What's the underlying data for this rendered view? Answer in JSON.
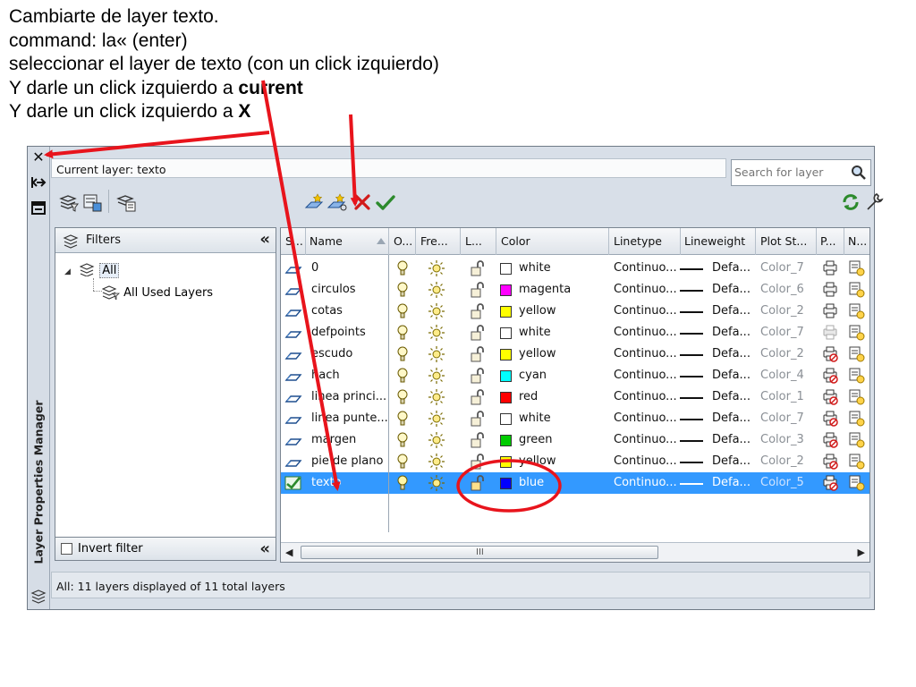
{
  "instructions": {
    "line1": "Cambiarte de layer texto.",
    "line2": "command: la« (enter)",
    "line3": "seleccionar el layer de texto  (con un click izquierdo)",
    "line4_prefix": "Y darle un click izquierdo a ",
    "line4_bold": "current",
    "line5_prefix": "Y darle un click izquierdo a ",
    "line5_bold": "X"
  },
  "window": {
    "palette_title": "Layer Properties Manager",
    "close_glyph": "✕",
    "current_layer": "Current layer: texto",
    "search_placeholder": "Search for layer",
    "status": "All: 11 layers displayed of 11 total layers"
  },
  "filters": {
    "header": "Filters",
    "collapse_glyph": "«",
    "tree": {
      "all": "All",
      "all_used": "All Used Layers"
    },
    "invert_filter": "Invert filter"
  },
  "columns": [
    "S...",
    "Name",
    "O...",
    "Fre...",
    "L...",
    "Color",
    "Linetype",
    "Lineweight",
    "Plot St...",
    "P...",
    "N..."
  ],
  "layers": [
    {
      "name": "0",
      "color_name": "white",
      "color_hex": "#ffffff",
      "linetype": "Continuo...",
      "lineweight": "Defa...",
      "plot_style": "Color_7",
      "selected": false
    },
    {
      "name": "circulos",
      "color_name": "magenta",
      "color_hex": "#ff00ff",
      "linetype": "Continuo...",
      "lineweight": "Defa...",
      "plot_style": "Color_6",
      "selected": false
    },
    {
      "name": "cotas",
      "color_name": "yellow",
      "color_hex": "#ffff00",
      "linetype": "Continuo...",
      "lineweight": "Defa...",
      "plot_style": "Color_2",
      "selected": false
    },
    {
      "name": "defpoints",
      "color_name": "white",
      "color_hex": "#ffffff",
      "linetype": "Continuo...",
      "lineweight": "Defa...",
      "plot_style": "Color_7",
      "selected": false
    },
    {
      "name": "escudo",
      "color_name": "yellow",
      "color_hex": "#ffff00",
      "linetype": "Continuo...",
      "lineweight": "Defa...",
      "plot_style": "Color_2",
      "selected": false
    },
    {
      "name": "hach",
      "color_name": "cyan",
      "color_hex": "#00ffff",
      "linetype": "Continuo...",
      "lineweight": "Defa...",
      "plot_style": "Color_4",
      "selected": false
    },
    {
      "name": "linea princi...",
      "color_name": "red",
      "color_hex": "#ff0000",
      "linetype": "Continuo...",
      "lineweight": "Defa...",
      "plot_style": "Color_1",
      "selected": false
    },
    {
      "name": "linea punte...",
      "color_name": "white",
      "color_hex": "#ffffff",
      "linetype": "Continuo...",
      "lineweight": "Defa...",
      "plot_style": "Color_7",
      "selected": false
    },
    {
      "name": "margen",
      "color_name": "green",
      "color_hex": "#00cc00",
      "linetype": "Continuo...",
      "lineweight": "Defa...",
      "plot_style": "Color_3",
      "selected": false
    },
    {
      "name": "pie de plano",
      "color_name": "yellow",
      "color_hex": "#ffff00",
      "linetype": "Continuo...",
      "lineweight": "Defa...",
      "plot_style": "Color_2",
      "selected": false
    },
    {
      "name": "texto",
      "color_name": "blue",
      "color_hex": "#0000ff",
      "linetype": "Continuo...",
      "lineweight": "Defa...",
      "plot_style": "Color_5",
      "selected": true
    }
  ],
  "scrollbar_grip": "III",
  "icons": {
    "new_filter": "new-property-filter-icon",
    "new_group": "new-group-filter-icon",
    "states": "layer-states-manager-icon",
    "new_layer": "new-layer-icon",
    "new_vp_layer": "new-layer-vp-frozen-icon",
    "delete": "delete-layer-icon",
    "set_current": "set-current-icon",
    "refresh": "refresh-icon",
    "settings": "settings-wrench-icon"
  },
  "annotation_colors": {
    "arrow": "#e8141c",
    "circle": "#e8141c"
  }
}
